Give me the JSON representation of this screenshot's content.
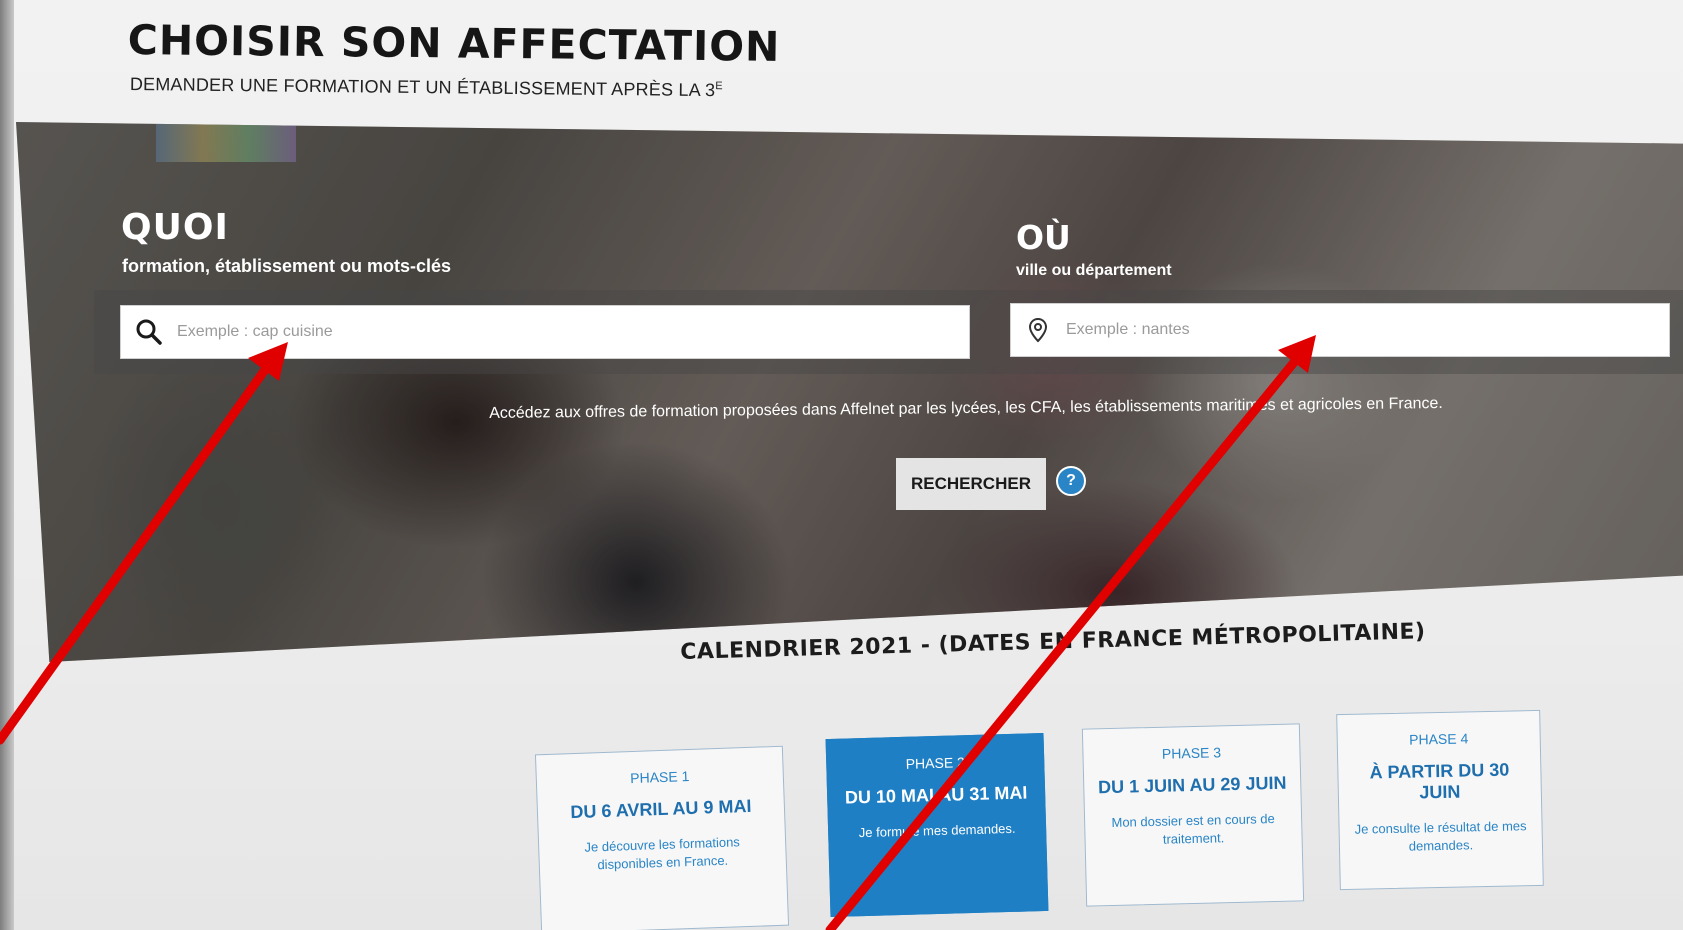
{
  "header": {
    "title": "CHOISIR SON AFFECTATION",
    "subtitle": "DEMANDER UNE FORMATION ET UN ÉTABLISSEMENT APRÈS LA 3",
    "subtitle_sup": "E"
  },
  "search": {
    "quoi_label": "QUOI",
    "quoi_hint": "formation, établissement ou mots-clés",
    "quoi_placeholder": "Exemple : cap cuisine",
    "ou_label": "OÙ",
    "ou_hint": "ville ou département",
    "ou_placeholder": "Exemple : nantes",
    "info": "Accédez aux offres de formation proposées dans Affelnet par les lycées, les CFA, les établissements maritimes et agricoles en France.",
    "button_label": "RECHERCHER",
    "help_label": "?"
  },
  "icons": {
    "search": "search-icon",
    "location": "location-pin-icon",
    "help": "help-icon"
  },
  "calendar": {
    "title": "CALENDRIER 2021 - (DATES EN FRANCE MÉTROPOLITAINE)",
    "phases": [
      {
        "label": "PHASE 1",
        "dates": "DU 6 AVRIL AU 9 MAI",
        "desc": "Je découvre les formations disponibles en France."
      },
      {
        "label": "PHASE 2",
        "dates": "DU 10 MAI AU 31 MAI",
        "desc": "Je formule mes demandes."
      },
      {
        "label": "PHASE 3",
        "dates": "DU 1 JUIN AU 29 JUIN",
        "desc": "Mon dossier est en cours de traitement."
      },
      {
        "label": "PHASE 4",
        "dates": "À PARTIR DU 30 JUIN",
        "desc": "Je consulte le résultat de mes demandes."
      }
    ]
  },
  "colors": {
    "accent_blue": "#1f7fc4",
    "annotation_red": "#e00000"
  }
}
